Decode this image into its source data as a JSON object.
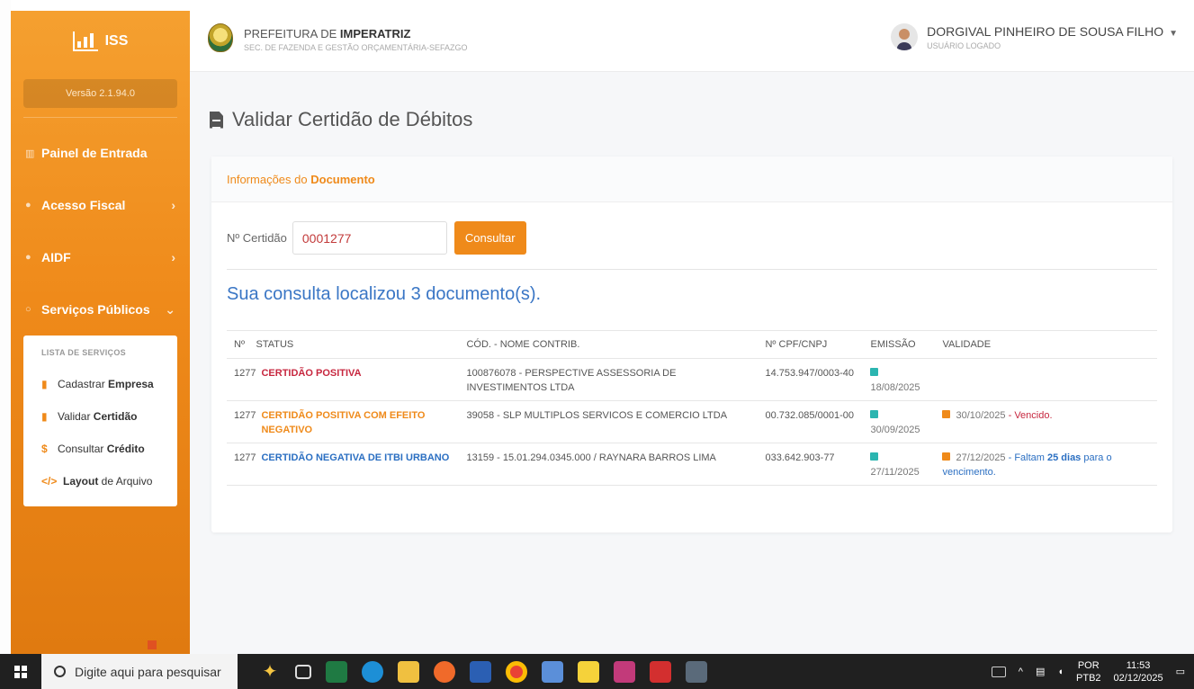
{
  "sidebar": {
    "brand": "ISS",
    "version": "Versão 2.1.94.0",
    "nav": [
      {
        "label": "Painel de Entrada"
      },
      {
        "label": "Acesso Fiscal",
        "chevron": "›"
      },
      {
        "label": "AIDF",
        "chevron": "›"
      },
      {
        "label": "Serviços Públicos",
        "chevron": "⌄"
      }
    ],
    "submenu_title": "LISTA DE SERVIÇOS",
    "submenu": [
      {
        "pre": "Cadastrar ",
        "bold": "Empresa",
        "icon": "file-icon"
      },
      {
        "pre": "Validar ",
        "bold": "Certidão",
        "icon": "file-icon"
      },
      {
        "pre": "Consultar ",
        "bold": "Crédito",
        "icon": "dollar-icon"
      },
      {
        "pre": "",
        "bold": "Layout",
        "post": " de Arquivo",
        "icon": "code-icon"
      }
    ]
  },
  "header": {
    "org_prefix": "PREFEITURA DE ",
    "org_bold": "IMPERATRIZ",
    "org_sub": "SEC. DE FAZENDA E GESTÃO ORÇAMENTÁRIA-SEFAZGO",
    "user_name": "DORGIVAL PINHEIRO DE SOUSA FILHO",
    "user_role": "USUÁRIO LOGADO"
  },
  "page": {
    "title": "Validar Certidão de Débitos",
    "panel_title_pre": "Informações do ",
    "panel_title_bold": "Documento",
    "field_label": "Nº Certidão",
    "field_value": "0001277",
    "button_label": "Consultar",
    "result_text": "Sua consulta localizou 3 documento(s)."
  },
  "table": {
    "headers": [
      "Nº",
      "STATUS",
      "CÓD. - NOME CONTRIB.",
      "Nº CPF/CNPJ",
      "EMISSÃO",
      "VALIDADE"
    ],
    "rows": [
      {
        "num": "1277",
        "status": "CERTIDÃO POSITIVA",
        "status_color": "#c7273f",
        "contrib": "100876078 - PERSPECTIVE ASSESSORIA DE INVESTIMENTOS LTDA",
        "doc": "14.753.947/0003-40",
        "emissao": "18/08/2025",
        "validade": "",
        "validade_note": ""
      },
      {
        "num": "1277",
        "status": "CERTIDÃO POSITIVA COM EFEITO NEGATIVO",
        "status_color": "#ef8a1a",
        "contrib": "39058 - SLP MULTIPLOS SERVICOS E COMERCIO LTDA",
        "doc": "00.732.085/0001-00",
        "emissao": "30/09/2025",
        "validade": "30/10/2025",
        "validade_note": " - Vencido."
      },
      {
        "num": "1277",
        "status": "CERTIDÃO NEGATIVA DE ITBI URBANO",
        "status_color": "#2b6fc2",
        "contrib": "13159 - 15.01.294.0345.000 / RAYNARA BARROS LIMA",
        "doc": "033.642.903-77",
        "emissao": "27/11/2025",
        "validade": "27/12/2025",
        "validade_note_pre": " - Faltam ",
        "validade_note_bold": "25 dias",
        "validade_note_post": " para o vencimento."
      }
    ]
  },
  "taskbar": {
    "search_placeholder": "Digite aqui para pesquisar",
    "lang_top": "POR",
    "lang_bottom": "PTB2",
    "time": "11:53",
    "date": "02/12/2025"
  },
  "colors": {
    "accent": "#ef8a1a",
    "link": "#3a76c5",
    "danger": "#c7273f"
  }
}
